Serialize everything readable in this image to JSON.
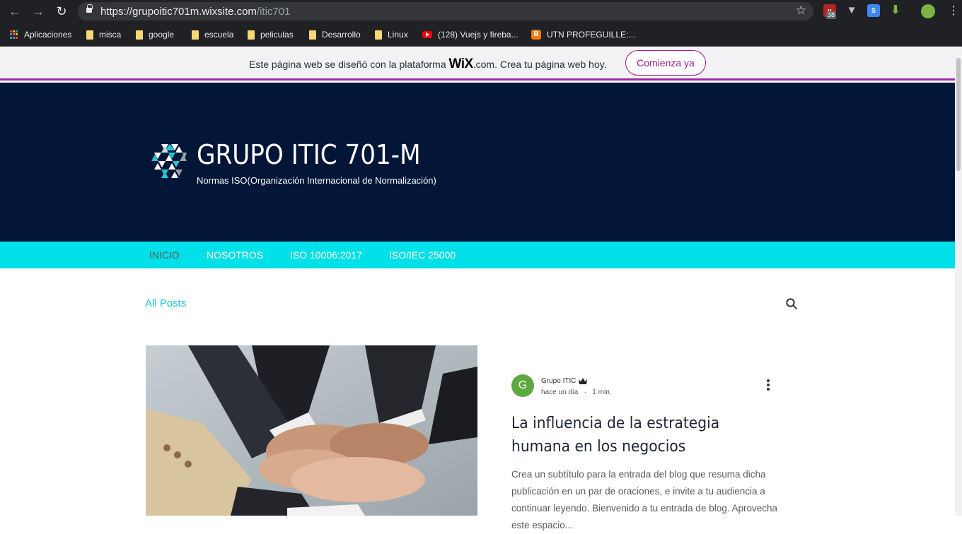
{
  "browser": {
    "url_host": "https://grupoitic701m.wixsite.com",
    "url_path": "/itic701",
    "extension_badge": "38",
    "bookmarks": [
      {
        "label": "Aplicaciones",
        "icon": "apps-grid-icon"
      },
      {
        "label": "misca",
        "icon": "folder-icon"
      },
      {
        "label": "google",
        "icon": "folder-icon"
      },
      {
        "label": "escuela",
        "icon": "folder-icon"
      },
      {
        "label": "peliculas",
        "icon": "folder-icon"
      },
      {
        "label": "Desarrollo",
        "icon": "folder-icon"
      },
      {
        "label": "Linux",
        "icon": "folder-icon"
      },
      {
        "label": "(128) Vuejs y fireba...",
        "icon": "youtube-icon"
      },
      {
        "label": "UTN PROFEGUILLE:...",
        "icon": "blogger-icon"
      }
    ]
  },
  "wix_banner": {
    "text_before": "Este página web se diseñó con la plataforma ",
    "logo_text": "WiX",
    "text_after": ".com. Crea tu página web hoy.",
    "cta_label": "Comienza ya",
    "accent_color": "#a11a8d"
  },
  "site": {
    "title": "GRUPO ITIC 701-M",
    "subtitle": "Normas ISO(Organización Internacional de Normalización)",
    "header_color": "#031638",
    "nav_color": "#00e0e8",
    "nav": [
      "INICIO",
      "NOSOTROS",
      "ISO 10006:2017",
      "ISO/IEC 25000"
    ]
  },
  "blog": {
    "filter_label": "All Posts",
    "post": {
      "avatar_letter": "G",
      "author": "Grupo ITIC",
      "time": "hace un día",
      "separator": "·",
      "read_time": "1 min.",
      "title": "La influencia de la estrategia humana en los negocios",
      "excerpt": "Crea un subtítulo para la entrada del blog que resuma dicha publicación en un par de oraciones, e invite a tu audiencia a continuar leyendo. Bienvenido a tu entrada de blog. Aprovecha este espacio..."
    }
  }
}
